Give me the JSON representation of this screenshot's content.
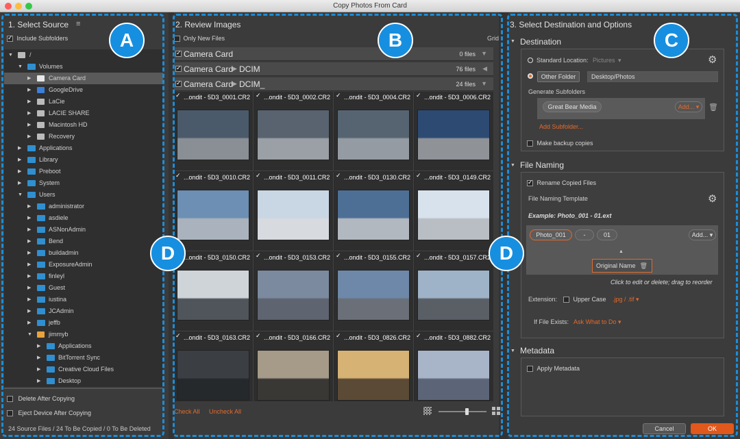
{
  "window": {
    "title": "Copy Photos From Card"
  },
  "labels": {
    "A": "A",
    "B": "B",
    "C": "C",
    "D_left": "D",
    "D_right": "D"
  },
  "source": {
    "title": "1. Select Source",
    "include_subfolders": "Include Subfolders",
    "tree": [
      {
        "label": "/",
        "indent": 0,
        "open": true,
        "icon": "drive-icon"
      },
      {
        "label": "Volumes",
        "indent": 1,
        "open": true,
        "icon": "folder-icon"
      },
      {
        "label": "Camera Card",
        "indent": 2,
        "open": false,
        "icon": "card-icon",
        "selected": true
      },
      {
        "label": "GoogleDrive",
        "indent": 2,
        "open": false,
        "icon": "cloud-icon"
      },
      {
        "label": "LaCie",
        "indent": 2,
        "open": false,
        "icon": "drive-icon"
      },
      {
        "label": "LACIE SHARE",
        "indent": 2,
        "open": false,
        "icon": "drive-icon"
      },
      {
        "label": "Macintosh HD",
        "indent": 2,
        "open": false,
        "icon": "drive-icon"
      },
      {
        "label": "Recovery",
        "indent": 2,
        "open": false,
        "icon": "drive-icon"
      },
      {
        "label": "Applications",
        "indent": 1,
        "open": false,
        "icon": "folder-icon"
      },
      {
        "label": "Library",
        "indent": 1,
        "open": false,
        "icon": "folder-icon"
      },
      {
        "label": "Preboot",
        "indent": 1,
        "open": false,
        "icon": "folder-icon"
      },
      {
        "label": "System",
        "indent": 1,
        "open": false,
        "icon": "folder-icon"
      },
      {
        "label": "Users",
        "indent": 1,
        "open": true,
        "icon": "folder-icon"
      },
      {
        "label": "administrator",
        "indent": 2,
        "open": false,
        "icon": "folder-icon"
      },
      {
        "label": "asdiele",
        "indent": 2,
        "open": false,
        "icon": "folder-icon"
      },
      {
        "label": "ASNonAdmin",
        "indent": 2,
        "open": false,
        "icon": "folder-icon"
      },
      {
        "label": "Bend",
        "indent": 2,
        "open": false,
        "icon": "folder-icon"
      },
      {
        "label": "buildadmin",
        "indent": 2,
        "open": false,
        "icon": "folder-icon"
      },
      {
        "label": "ExposureAdmin",
        "indent": 2,
        "open": false,
        "icon": "folder-icon"
      },
      {
        "label": "finleyl",
        "indent": 2,
        "open": false,
        "icon": "folder-icon"
      },
      {
        "label": "Guest",
        "indent": 2,
        "open": false,
        "icon": "folder-icon"
      },
      {
        "label": "iustina",
        "indent": 2,
        "open": false,
        "icon": "folder-icon"
      },
      {
        "label": "JCAdmin",
        "indent": 2,
        "open": false,
        "icon": "folder-icon"
      },
      {
        "label": "jeffb",
        "indent": 2,
        "open": false,
        "icon": "folder-icon"
      },
      {
        "label": "jimmyb",
        "indent": 2,
        "open": true,
        "icon": "home-icon"
      },
      {
        "label": "Applications",
        "indent": 3,
        "open": false,
        "icon": "folder-icon"
      },
      {
        "label": "BitTorrent Sync",
        "indent": 3,
        "open": false,
        "icon": "folder-icon"
      },
      {
        "label": "Creative Cloud Files",
        "indent": 3,
        "open": false,
        "icon": "folder-icon"
      },
      {
        "label": "Desktop",
        "indent": 3,
        "open": false,
        "icon": "folder-icon"
      }
    ],
    "delete_after": "Delete After Copying",
    "eject_after": "Eject Device After Copying",
    "status": "24 Source Files / 24 To Be Copied / 0 To Be Deleted"
  },
  "review": {
    "title": "2. Review Images",
    "only_new": "Only New Files",
    "grid_label": "Grid",
    "groups": [
      {
        "label": "Camera Card",
        "sub": "",
        "count": "0 files"
      },
      {
        "label": "Camera Card",
        "sub": "DCIM",
        "count": "76 files"
      },
      {
        "label": "Camera Card",
        "sub": "DCIM_",
        "count": "24 files"
      }
    ],
    "images": [
      {
        "name": "...ondit - 5D3_0001.CR2",
        "sky": "#4a5a6b",
        "ground": "#8a8f95"
      },
      {
        "name": "...ondit - 5D3_0002.CR2",
        "sky": "#58636f",
        "ground": "#9aa0a6"
      },
      {
        "name": "...ondit - 5D3_0004.CR2",
        "sky": "#566472",
        "ground": "#959ba2"
      },
      {
        "name": "...ondit - 5D3_0006.CR2",
        "sky": "#2d4a73",
        "ground": "#8f9398"
      },
      {
        "name": "...ondit - 5D3_0010.CR2",
        "sky": "#6c8fb3",
        "ground": "#aab3bd"
      },
      {
        "name": "...ondit - 5D3_0011.CR2",
        "sky": "#c9d6e3",
        "ground": "#d7dade"
      },
      {
        "name": "...ondit - 5D3_0130.CR2",
        "sky": "#4d6f96",
        "ground": "#b2b8bf"
      },
      {
        "name": "...ondit - 5D3_0149.CR2",
        "sky": "#d8e2ec",
        "ground": "#b9bec4"
      },
      {
        "name": "...ondit - 5D3_0150.CR2",
        "sky": "#cfd4d8",
        "ground": "#4f555b"
      },
      {
        "name": "...ondit - 5D3_0153.CR2",
        "sky": "#7b8a9e",
        "ground": "#5e6470"
      },
      {
        "name": "...ondit - 5D3_0155.CR2",
        "sky": "#6d88a8",
        "ground": "#6a6f78"
      },
      {
        "name": "...ondit - 5D3_0157.CR2",
        "sky": "#9eb3c8",
        "ground": "#5a5f66"
      },
      {
        "name": "...ondit - 5D3_0163.CR2",
        "sky": "#3b3e42",
        "ground": "#26292c"
      },
      {
        "name": "...ondit - 5D3_0166.CR2",
        "sky": "#a69a88",
        "ground": "#3a3835"
      },
      {
        "name": "...ondit - 5D3_0826.CR2",
        "sky": "#d6b274",
        "ground": "#5b4a35"
      },
      {
        "name": "...ondit - 5D3_0882.CR2",
        "sky": "#a8b4c8",
        "ground": "#5c6478"
      }
    ],
    "check_all": "Check All",
    "uncheck_all": "Uncheck All",
    "zoom_level": 0.58
  },
  "destination": {
    "title": "3. Select Destination and Options",
    "section_dest": "Destination",
    "standard_location": "Standard Location:",
    "standard_value": "Pictures",
    "other_folder": "Other Folder",
    "path": "Desktop/Photos",
    "generate_subfolders": "Generate Subfolders",
    "subfolder_token": "Great Bear Media",
    "add": "Add...",
    "add_subfolder": "Add Subfolder...",
    "backup": "Make backup copies",
    "section_naming": "File Naming",
    "rename": "Rename Copied Files",
    "template_label": "File Naming Template",
    "example": "Example: Photo_001 - 01.ext",
    "tokens": [
      "Photo_001",
      "-",
      "01"
    ],
    "add2": "Add...",
    "popup": "Original Name",
    "hint": "Click to edit or delete; drag to reorder",
    "extension": "Extension:",
    "upper": "Upper Case",
    "ext_value": ".jpg / .tif",
    "if_exists": "If File Exists:",
    "ask": "Ask What to Do",
    "section_meta": "Metadata",
    "apply_meta": "Apply Metadata",
    "cancel": "Cancel",
    "ok": "OK"
  },
  "colors": {
    "accent": "#e36b2d",
    "callout": "#178fe0",
    "folder": "#2f8fd1"
  }
}
